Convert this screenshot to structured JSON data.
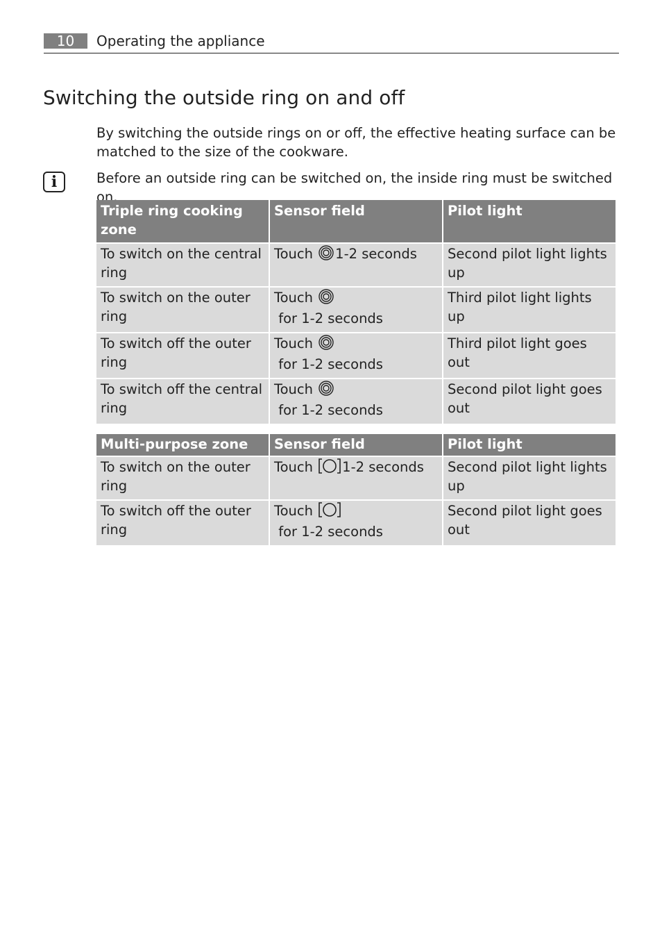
{
  "header": {
    "page_number": "10",
    "section": "Operating the appliance"
  },
  "title": "Switching the outside ring on and off",
  "intro": "By switching the outside rings on or off, the effective heating surface can be matched to the size of the cookware.",
  "info": {
    "icon": "info-icon",
    "text": "Before an outside ring can be switched on, the inside ring must be switched on."
  },
  "table1": {
    "headers": [
      "Triple ring cooking zone",
      "Sensor field",
      "Pilot light"
    ],
    "rows": [
      {
        "action": "To switch on the central ring",
        "sensor_prefix": "Touch",
        "sensor_icon": "triple-ring-icon",
        "sensor_suffix": "1-2 seconds",
        "pilot": "Second pilot light lights up"
      },
      {
        "action": "To switch on the outer ring",
        "sensor_prefix": "Touch",
        "sensor_icon": "triple-ring-icon",
        "sensor_suffix": " for 1-2 seconds",
        "pilot": "Third pilot light lights up"
      },
      {
        "action": "To switch off the outer ring",
        "sensor_prefix": "Touch",
        "sensor_icon": "triple-ring-icon",
        "sensor_suffix": " for 1-2 seconds",
        "pilot": "Third pilot light goes out"
      },
      {
        "action": "To switch off the central ring",
        "sensor_prefix": "Touch",
        "sensor_icon": "triple-ring-icon",
        "sensor_suffix": " for 1-2 seconds",
        "pilot": "Second pilot light goes out"
      }
    ]
  },
  "table2": {
    "headers": [
      "Multi-purpose zone",
      "Sensor field",
      "Pilot light"
    ],
    "rows": [
      {
        "action": "To switch on the outer ring",
        "sensor_prefix": "Touch",
        "sensor_icon": "multi-purpose-zone-icon",
        "sensor_suffix": "1-2 seconds",
        "pilot": "Second pilot light lights up"
      },
      {
        "action": "To switch off the outer ring",
        "sensor_prefix": "Touch",
        "sensor_icon": "multi-purpose-zone-icon",
        "sensor_suffix": " for 1-2 seconds",
        "pilot": "Second pilot light goes out"
      }
    ]
  }
}
